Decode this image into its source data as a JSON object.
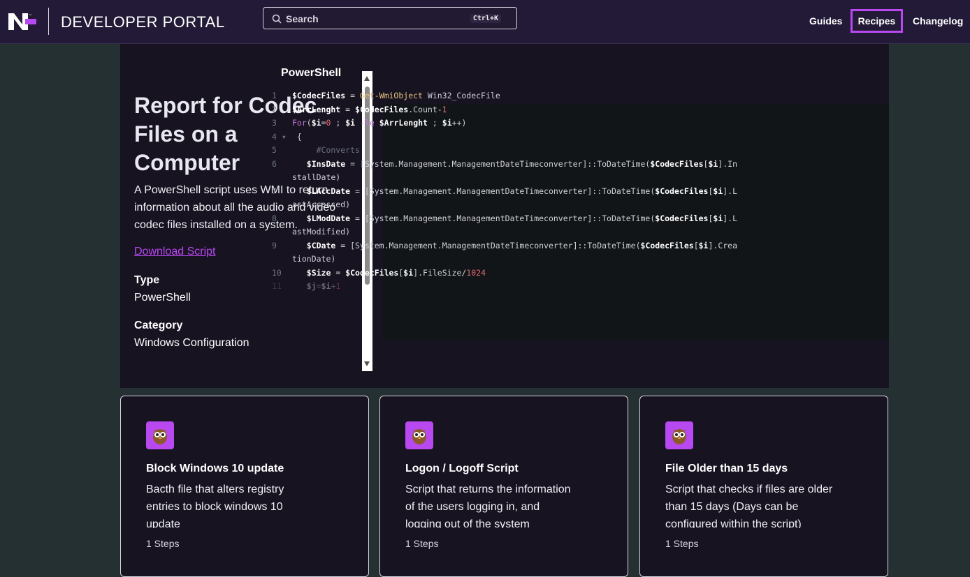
{
  "header": {
    "brand": "DEVELOPER PORTAL",
    "search_placeholder": "Search",
    "search_shortcut": "Ctrl+K",
    "nav": {
      "guides": "Guides",
      "recipes": "Recipes",
      "changelog": "Changelog"
    }
  },
  "recipe": {
    "title": "Report for Codec Files on a Computer",
    "description": "A PowerShell script uses WMI to return information about all the audio and video codec files installed on a system.",
    "download_label": "Download Script",
    "type_label": "Type",
    "type_value": "PowerShell",
    "category_label": "Category",
    "category_value": "Windows Configuration"
  },
  "code": {
    "language": "PowerShell",
    "lines": [
      {
        "n": "1",
        "text": "$CodecFiles = Get-WmiObject Win32_CodecFile"
      },
      {
        "n": "2",
        "text": "$ArrLenght = $CodecFiles.Count-1"
      },
      {
        "n": "3",
        "text": "For($i=0 ; $i -le $ArrLenght ; $i++)"
      },
      {
        "n": "4 ▾",
        "text": " {"
      },
      {
        "n": "5",
        "text": "     #Converts"
      },
      {
        "n": "6",
        "text": "   $InsDate = [System.Management.ManagementDateTimeconverter]::ToDateTime($CodecFiles[$i].In"
      },
      {
        "n": "",
        "text": "stallDate)"
      },
      {
        "n": "7",
        "text": "   $LAccDate = [System.Management.ManagementDateTimeconverter]::ToDateTime($CodecFiles[$i].L"
      },
      {
        "n": "",
        "text": "astAccessed)"
      },
      {
        "n": "8",
        "text": "   $LModDate = [System.Management.ManagementDateTimeconverter]::ToDateTime($CodecFiles[$i].L"
      },
      {
        "n": "",
        "text": "astModified)"
      },
      {
        "n": "9",
        "text": "   $CDate = [System.Management.ManagementDateTimeconverter]::ToDateTime($CodecFiles[$i].Crea"
      },
      {
        "n": "",
        "text": "tionDate)"
      },
      {
        "n": "10",
        "text": "   $Size = $CodecFiles[$i].FileSize/1024"
      },
      {
        "n": "11",
        "text": "   $j=$i+1"
      }
    ]
  },
  "cards": [
    {
      "title": "Block Windows 10 update",
      "description": "Bacth file that alters registry entries to block windows 10 update",
      "steps": "1 Steps"
    },
    {
      "title": "Logon / Logoff Script",
      "description": "Script that returns the information of the users logging in, and logging out of the system",
      "steps": "1 Steps"
    },
    {
      "title": "File Older than 15 days",
      "description": "Script that checks if files are older than 15 days (Days can be configured within the script)",
      "steps": "1 Steps"
    }
  ],
  "colors": {
    "accent": "#b848f0",
    "header_bg": "#231a37",
    "panel_bg": "#171321",
    "page_bg": "#253033"
  },
  "icons": [
    "brand-logo-icon",
    "search-icon",
    "owl-icon"
  ]
}
